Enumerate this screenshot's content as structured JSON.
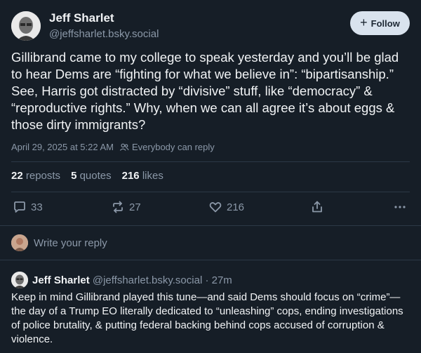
{
  "post": {
    "author_name": "Jeff Sharlet",
    "author_handle": "@jeffsharlet.bsky.social",
    "follow_label": "Follow",
    "text": "Gillibrand came to my college to speak yesterday and you’ll be glad to hear Dems are “fighting for what we believe in”: “bipartisanship.” See, Harris got distracted by “divisive” stuff, like “democracy” & “reproductive rights.” Why, when we can all agree it’s about eggs & those dirty immigrants?",
    "timestamp": "April 29, 2025 at 5:22 AM",
    "reply_permission": "Everybody can reply",
    "stats": {
      "reposts_count": "22",
      "reposts_label": "reposts",
      "quotes_count": "5",
      "quotes_label": "quotes",
      "likes_count": "216",
      "likes_label": "likes"
    },
    "actions": {
      "reply_count": "33",
      "repost_count": "27",
      "like_count": "216"
    }
  },
  "composer": {
    "placeholder": "Write your reply"
  },
  "reply": {
    "author_name": "Jeff Sharlet",
    "author_handle": "@jeffsharlet.bsky.social",
    "separator": "·",
    "age": "27m",
    "text": "Keep in mind Gillibrand played this tune—and said Dems should focus on “crime”—the day of a Trump EO literally dedicated to “unleashing” cops, ending investigations of police brutality, & putting federal backing behind cops accused of corruption & violence."
  },
  "icons": {
    "reply": "speech-bubble-icon",
    "repost": "repost-arrows-icon",
    "like": "heart-icon",
    "share": "share-icon",
    "more": "ellipsis-icon",
    "people": "people-icon"
  },
  "colors": {
    "background": "#161e27",
    "muted": "#8b98a8",
    "follow_bg": "#d9e3ee"
  }
}
